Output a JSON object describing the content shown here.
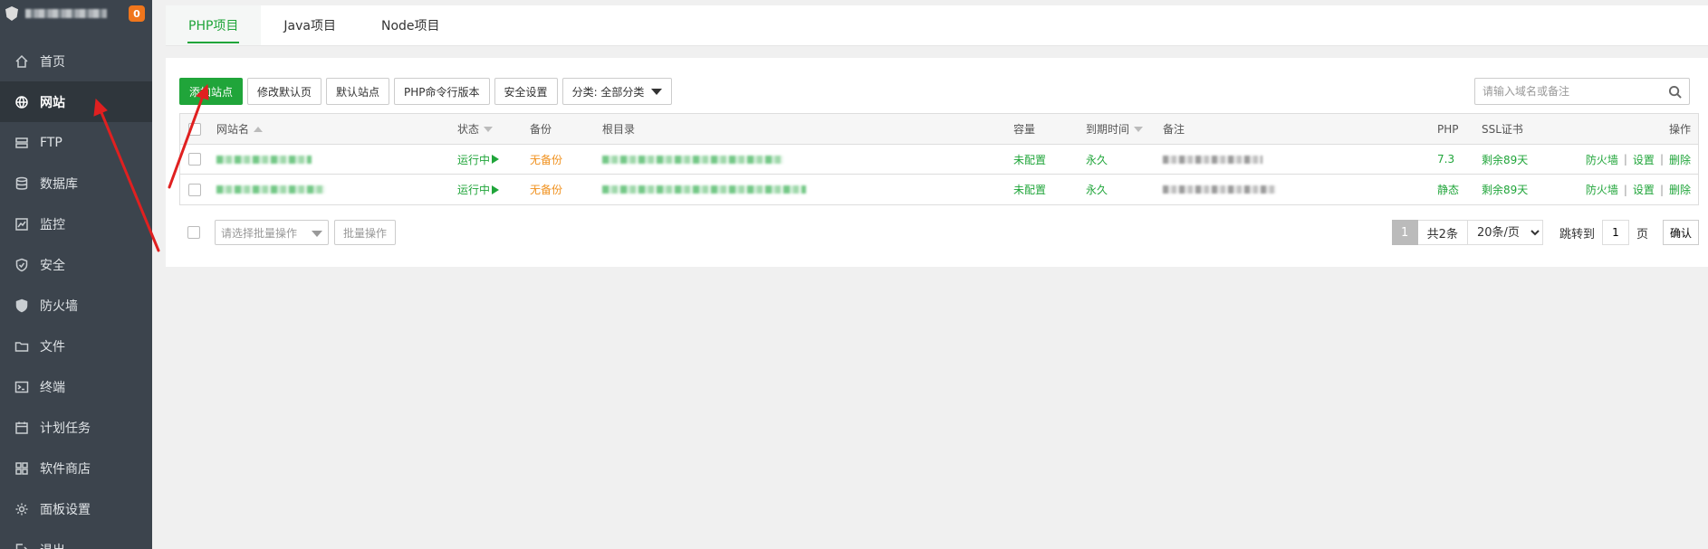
{
  "sidebar": {
    "badge": "0",
    "items": [
      {
        "label": "首页",
        "icon": "home-icon"
      },
      {
        "label": "网站",
        "icon": "globe-icon",
        "active": true
      },
      {
        "label": "FTP",
        "icon": "ftp-icon"
      },
      {
        "label": "数据库",
        "icon": "database-icon"
      },
      {
        "label": "监控",
        "icon": "monitor-icon"
      },
      {
        "label": "安全",
        "icon": "shield-icon"
      },
      {
        "label": "防火墙",
        "icon": "firewall-icon"
      },
      {
        "label": "文件",
        "icon": "folder-icon"
      },
      {
        "label": "终端",
        "icon": "terminal-icon"
      },
      {
        "label": "计划任务",
        "icon": "calendar-icon"
      },
      {
        "label": "软件商店",
        "icon": "apps-icon"
      },
      {
        "label": "面板设置",
        "icon": "gear-icon"
      },
      {
        "label": "退出",
        "icon": "logout-icon"
      }
    ]
  },
  "tabs": [
    "PHP项目",
    "Java项目",
    "Node项目"
  ],
  "toolbar": {
    "add_site": "添加站点",
    "edit_default_page": "修改默认页",
    "default_site": "默认站点",
    "php_cli_version": "PHP命令行版本",
    "security_settings": "安全设置",
    "category": "分类: 全部分类"
  },
  "search": {
    "placeholder": "请输入域名或备注"
  },
  "table": {
    "headers": {
      "name": "网站名",
      "status": "状态",
      "backup": "备份",
      "root": "根目录",
      "quota": "容量",
      "expire": "到期时间",
      "remark": "备注",
      "php": "PHP",
      "ssl": "SSL证书",
      "ops": "操作"
    },
    "rows": [
      {
        "status": "运行中",
        "backup": "无备份",
        "quota": "未配置",
        "expire": "永久",
        "php": "7.3",
        "ssl": "剩余89天",
        "op_firewall": "防火墙",
        "op_settings": "设置",
        "op_delete": "删除"
      },
      {
        "status": "运行中",
        "backup": "无备份",
        "quota": "未配置",
        "expire": "永久",
        "php": "静态",
        "ssl": "剩余89天",
        "op_firewall": "防火墙",
        "op_settings": "设置",
        "op_delete": "删除"
      }
    ]
  },
  "footer": {
    "batch_placeholder": "请选择批量操作",
    "batch_button": "批量操作",
    "page_current": "1",
    "total": "共2条",
    "page_size": "20条/页",
    "jump_label": "跳转到",
    "jump_value": "1",
    "page_unit": "页",
    "confirm": "确认"
  },
  "colors": {
    "accent": "#20a53a",
    "sidebar_bg": "#3c444d",
    "warning": "#f0901c",
    "badge": "#f0761c",
    "annotation": "#e02020"
  }
}
